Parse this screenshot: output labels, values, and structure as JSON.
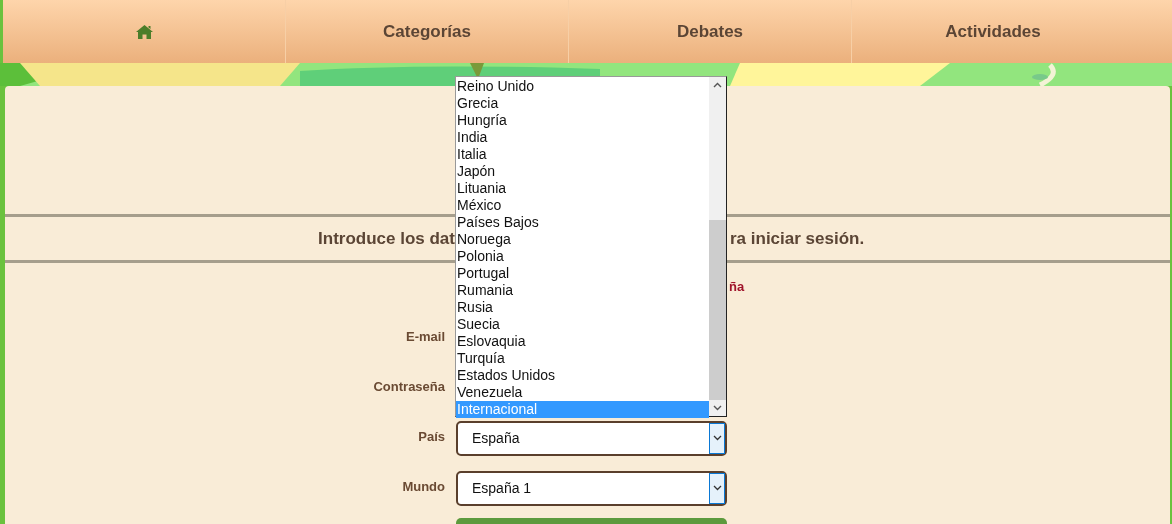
{
  "nav": {
    "tabs": [
      {
        "kind": "home"
      },
      {
        "kind": "text",
        "label": "Categorías"
      },
      {
        "kind": "text",
        "label": "Debates"
      },
      {
        "kind": "text",
        "label": "Actividades"
      }
    ]
  },
  "login": {
    "heading_left": "Introduce los dat",
    "heading_right": "ra iniciar sesión.",
    "notice": "ña",
    "fields": [
      {
        "label": "E-mail"
      },
      {
        "label": "Contraseña"
      },
      {
        "label": "País",
        "kind": "select",
        "value": "España"
      },
      {
        "label": "Mundo",
        "kind": "select",
        "value": "España 1"
      }
    ]
  },
  "country_list": {
    "options": [
      {
        "label": "Reino Unido",
        "selected": false
      },
      {
        "label": "Grecia",
        "selected": false
      },
      {
        "label": "Hungría",
        "selected": false
      },
      {
        "label": "India",
        "selected": false
      },
      {
        "label": "Italia",
        "selected": false
      },
      {
        "label": "Japón",
        "selected": false
      },
      {
        "label": "Lituania",
        "selected": false
      },
      {
        "label": "México",
        "selected": false
      },
      {
        "label": "Países Bajos",
        "selected": false
      },
      {
        "label": "Noruega",
        "selected": false
      },
      {
        "label": "Polonia",
        "selected": false
      },
      {
        "label": "Portugal",
        "selected": false
      },
      {
        "label": "Rumania",
        "selected": false
      },
      {
        "label": "Rusia",
        "selected": false
      },
      {
        "label": "Suecia",
        "selected": false
      },
      {
        "label": "Eslovaquia",
        "selected": false
      },
      {
        "label": "Turquía",
        "selected": false
      },
      {
        "label": "Estados Unidos",
        "selected": false
      },
      {
        "label": "Venezuela",
        "selected": false
      },
      {
        "label": "Internacional",
        "selected": true
      }
    ]
  }
}
